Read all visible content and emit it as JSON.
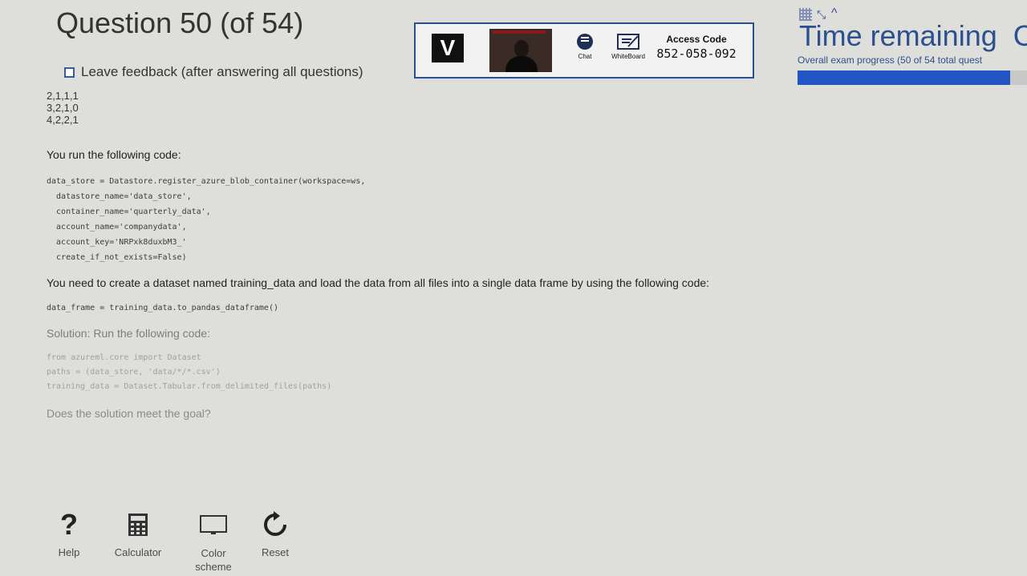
{
  "header": {
    "question_title": "Question 50 (of 54)",
    "feedback_label": "Leave feedback (after answering all questions)"
  },
  "toolbar": {
    "logo_letter": "V",
    "chat_label": "Chat",
    "whiteboard_label": "WhiteBoard",
    "access_code_label": "Access Code",
    "access_code_value": "852-058-092"
  },
  "status": {
    "time_label": "Time remaining",
    "time_value_partial": "C",
    "progress_text": "Overall exam progress (50 of 54 total quest",
    "progress_fraction": 0.926
  },
  "question": {
    "answer_rows": [
      "2,1,1,1",
      "3,2,1,0",
      "4,2,2,1"
    ],
    "intro_text": "You run the following code:",
    "code1": [
      "data_store = Datastore.register_azure_blob_container(workspace=ws,",
      "  datastore_name='data_store',",
      "  container_name='quarterly_data',",
      "  account_name='companydata',",
      "  account_key='NRPxk8duxbM3_'",
      "  create_if_not_exists=False)"
    ],
    "need_text": "You need to create a dataset named training_data and load the data from all files into a single data frame by using the following code:",
    "code2": "data_frame = training_data.to_pandas_dataframe()",
    "solution_text": "Solution: Run the following code:",
    "code3": [
      "from azureml.core import Dataset",
      "paths = (data_store, 'data/*/*.csv')",
      "training_data = Dataset.Tabular.from_delimited_files(paths)"
    ],
    "goal_text": "Does the solution meet the goal?"
  },
  "tools": {
    "help_label": "Help",
    "calculator_label": "Calculator",
    "color_scheme_label": "Color scheme",
    "reset_label": "Reset"
  }
}
